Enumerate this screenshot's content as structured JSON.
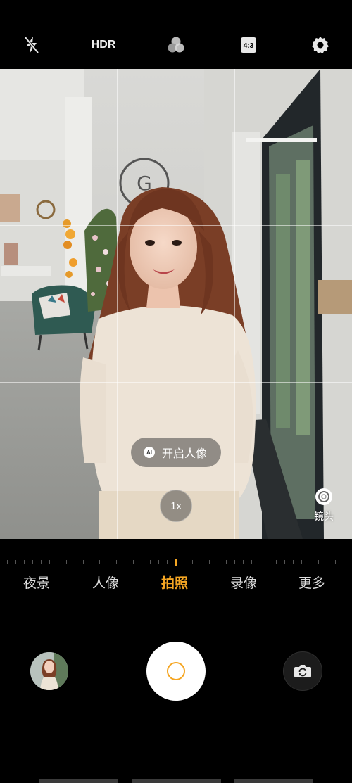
{
  "topbar": {
    "flash_icon": "flash-off-icon",
    "hdr_label": "HDR",
    "filter_icon": "filter-circles-icon",
    "ratio_label": "4:3",
    "settings_icon": "gear-icon"
  },
  "viewfinder": {
    "portrait_badge": "AI",
    "portrait_label": "开启人像",
    "zoom_label": "1x",
    "lens_label": "镜头",
    "lens_icon": "lens-icon"
  },
  "modes": {
    "items": [
      "夜景",
      "人像",
      "拍照",
      "录像",
      "更多"
    ],
    "active_index": 2
  },
  "controls": {
    "gallery_icon": "gallery-thumbnail",
    "shutter_icon": "shutter-icon",
    "switch_icon": "camera-switch-icon"
  },
  "colors": {
    "accent": "#f5a623",
    "background": "#000000"
  }
}
